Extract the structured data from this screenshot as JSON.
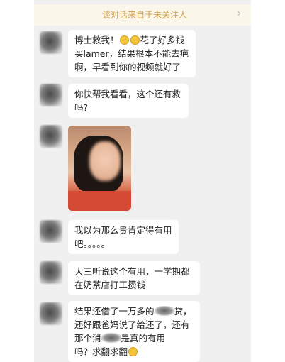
{
  "notice": {
    "text": "该对话来自于未关注人",
    "chevron": "›"
  },
  "messages": [
    {
      "kind": "text",
      "lines": [
        [
          "博士救我！",
          "emoji",
          "emoji",
          "花了好多钱"
        ],
        [
          "买lamer，结果根本不能去疤"
        ],
        [
          "啊，早看到你的视频就好了"
        ]
      ]
    },
    {
      "kind": "text",
      "lines": [
        [
          "你快帮我看看，这个还有救"
        ],
        [
          "吗?"
        ]
      ]
    },
    {
      "kind": "image",
      "alt": "face-photo"
    },
    {
      "kind": "text",
      "lines": [
        [
          "我以为那么贵肯定得有用"
        ],
        [
          "吧。。。。。"
        ]
      ]
    },
    {
      "kind": "text",
      "lines": [
        [
          "大三听说这个有用，一学期都"
        ],
        [
          "在奶茶店打工攒钱"
        ]
      ]
    },
    {
      "kind": "text",
      "lines": [
        [
          "结果还借了一万多的",
          "blot",
          "贷，"
        ],
        [
          "还好跟爸妈说了给还了，还有"
        ],
        [
          "那个消",
          "blot",
          "是真的有用"
        ],
        [
          "吗？求翻求翻",
          "emoji"
        ]
      ]
    }
  ],
  "text": {
    "m1l1a": "博士救我！",
    "m1l1b": "花了好多钱",
    "m1l2": "买lamer，结果根本不能去疤",
    "m1l3": "啊，早看到你的视频就好了",
    "m2l1": "你快帮我看看，这个还有救",
    "m2l2": "吗?",
    "m4l1": "我以为那么贵肯定得有用",
    "m4l2": "吧。。。。。",
    "m5l1": "大三听说这个有用，一学期都",
    "m5l2": "在奶茶店打工攒钱",
    "m6l1a": "结果还借了一万多的",
    "m6l1b": "贷，",
    "m6l2": "还好跟爸妈说了给还了，还有",
    "m6l3a": "那个消",
    "m6l3b": "是真的有用",
    "m6l4": "吗？求翻求翻"
  },
  "icons": {
    "emoji": "crying-face-emoji-icon",
    "avatar": "blurred-avatar",
    "chevron": "chevron-right-icon"
  },
  "colors": {
    "background": "#f0f0f0",
    "notice_bg": "#fbf6ea",
    "notice_text": "#d0a050",
    "bubble": "#ffffff"
  }
}
